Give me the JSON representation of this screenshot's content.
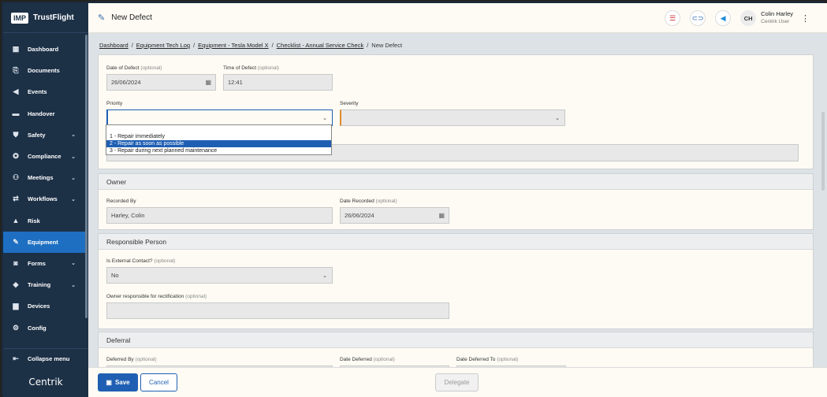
{
  "app": {
    "logo_mark": "IMP",
    "logo_text": "TrustFlight",
    "brand_footer": "Centrik"
  },
  "sidebar": {
    "items": [
      {
        "label": "Dashboard",
        "icon": "dashboard-icon",
        "chevron": false
      },
      {
        "label": "Documents",
        "icon": "paperclip-icon",
        "chevron": false
      },
      {
        "label": "Events",
        "icon": "megaphone-icon",
        "chevron": false
      },
      {
        "label": "Handover",
        "icon": "inbox-icon",
        "chevron": false
      },
      {
        "label": "Safety",
        "icon": "shield-icon",
        "chevron": true
      },
      {
        "label": "Compliance",
        "icon": "ribbon-icon",
        "chevron": true
      },
      {
        "label": "Meetings",
        "icon": "people-icon",
        "chevron": true
      },
      {
        "label": "Workflows",
        "icon": "workflow-icon",
        "chevron": true
      },
      {
        "label": "Risk",
        "icon": "warning-icon",
        "chevron": false
      },
      {
        "label": "Equipment",
        "icon": "wrench-icon",
        "chevron": false,
        "active": true
      },
      {
        "label": "Forms",
        "icon": "forms-icon",
        "chevron": true
      },
      {
        "label": "Training",
        "icon": "graduation-icon",
        "chevron": true
      },
      {
        "label": "Devices",
        "icon": "devices-icon",
        "chevron": false
      },
      {
        "label": "Config",
        "icon": "config-icon",
        "chevron": false
      }
    ],
    "collapse_label": "Collapse menu"
  },
  "header": {
    "title": "New Defect",
    "user_initials": "CH",
    "user_name": "Colin Harley",
    "user_role": "Centrik User"
  },
  "breadcrumb": {
    "items": [
      "Dashboard",
      "Equipment Tech Log",
      "Equipment - Tesla Model X",
      "Checklist - Annual Service Check"
    ],
    "current": "New Defect"
  },
  "form": {
    "date_of_defect": {
      "label": "Date of Defect",
      "optional": "(optional)",
      "value": "26/06/2024"
    },
    "time_of_defect": {
      "label": "Time of Defect",
      "optional": "(optional)",
      "value": "12:41"
    },
    "priority": {
      "label": "Priority",
      "value": ""
    },
    "severity": {
      "label": "Severity",
      "value": ""
    },
    "priority_options": [
      "1 - Repair immediately",
      "2 - Repair as soon as possible",
      "3 - Repair during next planned maintenance"
    ],
    "priority_highlighted": "2 - Repair as soon as possible"
  },
  "owner": {
    "title": "Owner",
    "recorded_by": {
      "label": "Recorded By",
      "value": "Harley, Colin"
    },
    "date_recorded": {
      "label": "Date Recorded",
      "optional": "(optional)",
      "value": "26/06/2024"
    }
  },
  "responsible": {
    "title": "Responsible Person",
    "is_external": {
      "label": "Is External Contact?",
      "optional": "(optional)",
      "value": "No"
    },
    "owner_rectification": {
      "label": "Owner responsible for rectification",
      "optional": "(optional)",
      "value": ""
    }
  },
  "deferral": {
    "title": "Deferral",
    "deferred_by": {
      "label": "Deferred By",
      "optional": "(optional)"
    },
    "date_deferred": {
      "label": "Date Deferred",
      "optional": "(optional)"
    },
    "date_deferred_to": {
      "label": "Date Deferred To",
      "optional": "(optional)"
    }
  },
  "footer": {
    "save": "Save",
    "cancel": "Cancel",
    "delegate": "Delegate"
  }
}
